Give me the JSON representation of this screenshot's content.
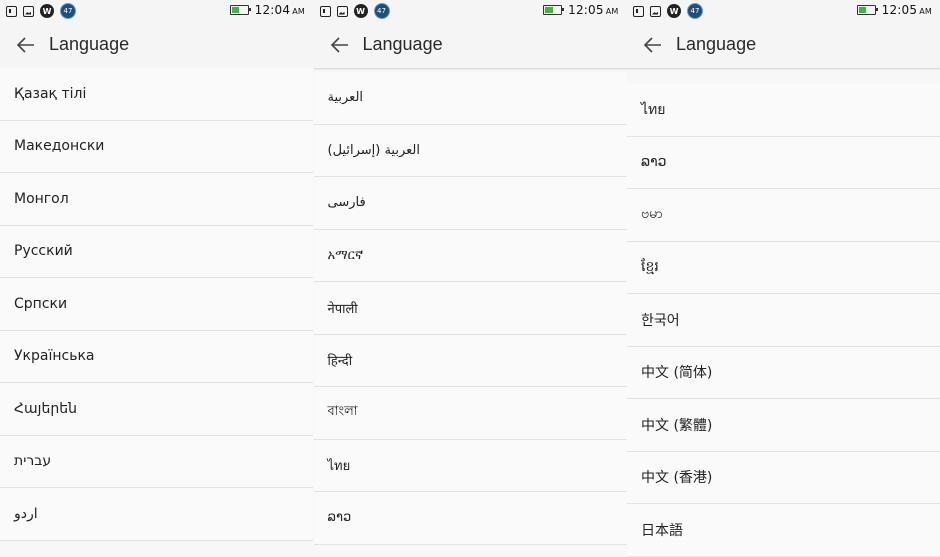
{
  "screens": [
    {
      "status": {
        "time": "12:04",
        "ampm": "AM",
        "badge": "47",
        "w": "W",
        "battery_level": 0.45,
        "battery_color": "#3bb93b"
      },
      "header": {
        "title": "Language",
        "back_icon": "arrow-left-icon"
      },
      "items": [
        "Қазақ тілі",
        "Македонски",
        "Монгол",
        "Русский",
        "Српски",
        "Українська",
        "Հայերեն",
        "עברית",
        "اردو"
      ]
    },
    {
      "status": {
        "time": "12:05",
        "ampm": "AM",
        "badge": "47",
        "w": "W",
        "battery_level": 0.45,
        "battery_color": "#3bb93b"
      },
      "header": {
        "title": "Language",
        "back_icon": "arrow-left-icon"
      },
      "items": [
        "العربية",
        "العربية (إسرائيل)",
        "فارسی",
        "አማርኛ",
        "नेपाली",
        "हिन्दी",
        "বাংলা",
        "ไทย",
        "ລາວ"
      ]
    },
    {
      "status": {
        "time": "12:05",
        "ampm": "AM",
        "badge": "47",
        "w": "W",
        "battery_level": 0.45,
        "battery_color": "#3bb93b"
      },
      "header": {
        "title": "Language",
        "back_icon": "arrow-left-icon"
      },
      "items": [
        "ไทย",
        "ລາວ",
        "ဗမာ",
        "ខ្មែរ",
        "한국어",
        "中文 (简体)",
        "中文 (繁體)",
        "中文 (香港)",
        "日本語"
      ]
    }
  ]
}
